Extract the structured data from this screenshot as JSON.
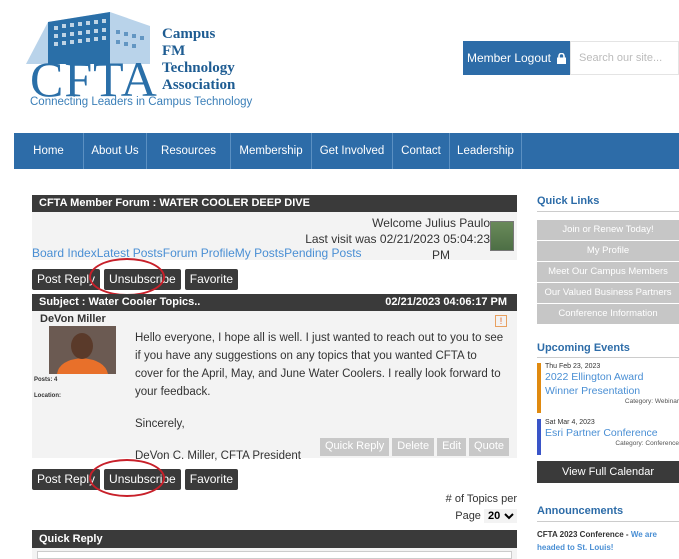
{
  "header": {
    "logo_letters": "CFTA",
    "org_name_lines": [
      "Campus",
      "FM",
      "Technology",
      "Association"
    ],
    "tagline": "Connecting Leaders in Campus Technology",
    "logout_label": "Member Logout",
    "search_placeholder": "Search our site..."
  },
  "nav": {
    "items": [
      {
        "label": "Home"
      },
      {
        "label": "About Us"
      },
      {
        "label": "Resources"
      },
      {
        "label": "Membership"
      },
      {
        "label": "Get Involved"
      },
      {
        "label": "Contact"
      },
      {
        "label": "Leadership"
      }
    ]
  },
  "forum": {
    "title": "CFTA Member Forum : WATER COOLER DEEP DIVE",
    "welcome": "Welcome Julius Paulo",
    "last_visit": "Last visit was 02/21/2023 05:04:23",
    "last_visit_pm": "PM",
    "links": [
      "Board Index",
      "Latest Posts",
      "Forum Profile",
      "My Posts",
      "Pending Posts"
    ],
    "buttons": {
      "post_reply": "Post Reply",
      "unsubscribe": "Unsubscribe",
      "favorite": "Favorite"
    },
    "subject": "Subject : Water Cooler Topics..",
    "post_date": "02/21/2023 04:06:17 PM",
    "post": {
      "author": "DeVon Miller",
      "posts_label": "Posts:",
      "posts_count": "4",
      "location_label": "Location:",
      "flag": "!",
      "body": "Hello everyone, I hope all is well. I just wanted to reach out to you to see if you have any suggestions on any topics that you wanted CFTA to cover for the April, May, and June Water Coolers. I really look forward to your feedback.",
      "closing": "Sincerely,",
      "signature": "DeVon C. Miller, CFTA President",
      "actions": [
        "Quick Reply",
        "Delete",
        "Edit",
        "Quote"
      ]
    },
    "pager": {
      "label": "# of Topics per",
      "page_label": "Page",
      "value": "20"
    },
    "quick_reply_title": "Quick Reply"
  },
  "sidebar": {
    "quick_links_title": "Quick Links",
    "quick_links": [
      "Join or Renew Today!",
      "My Profile",
      "Meet Our Campus Members",
      "Our Valued Business Partners",
      "Conference Information"
    ],
    "events_title": "Upcoming Events",
    "events": [
      {
        "date": "Thu Feb 23, 2023",
        "title": "2022 Ellington Award Winner Presentation",
        "category": "Category: Webinar",
        "color": "#e08a10"
      },
      {
        "date": "Sat Mar 4, 2023",
        "title": "Esri Partner Conference",
        "category": "Category: Conference",
        "color": "#3a55c8"
      }
    ],
    "calendar_button": "View Full Calendar",
    "announcements_title": "Announcements",
    "announcement": {
      "title": "CFTA 2023 Conference",
      "sep": " - ",
      "link": "We are headed to St. Louis!"
    }
  },
  "colors": {
    "brand_blue": "#2d6ca8",
    "dark_bar": "#3a3a3a",
    "highlight_red": "#c8202a"
  }
}
